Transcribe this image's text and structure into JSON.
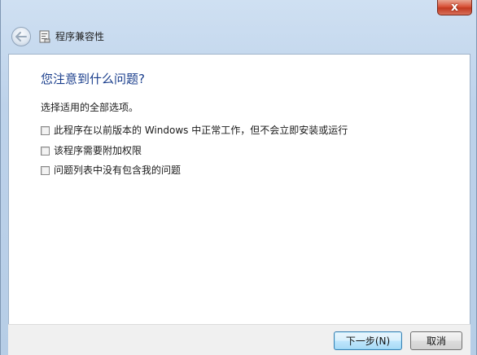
{
  "window": {
    "title": "程序兼容性",
    "close_label": "x"
  },
  "page": {
    "heading": "您注意到什么问题?",
    "instruction": "选择适用的全部选项。",
    "options": [
      {
        "label": "此程序在以前版本的 Windows 中正常工作，但不会立即安装或运行",
        "checked": false
      },
      {
        "label": "该程序需要附加权限",
        "checked": false
      },
      {
        "label": "问题列表中没有包含我的问题",
        "checked": false
      }
    ]
  },
  "buttons": {
    "next": "下一步(N)",
    "cancel": "取消"
  },
  "colors": {
    "heading": "#1a3e8c",
    "close_button": "#c23a21",
    "default_button_border": "#3c7fb1"
  }
}
